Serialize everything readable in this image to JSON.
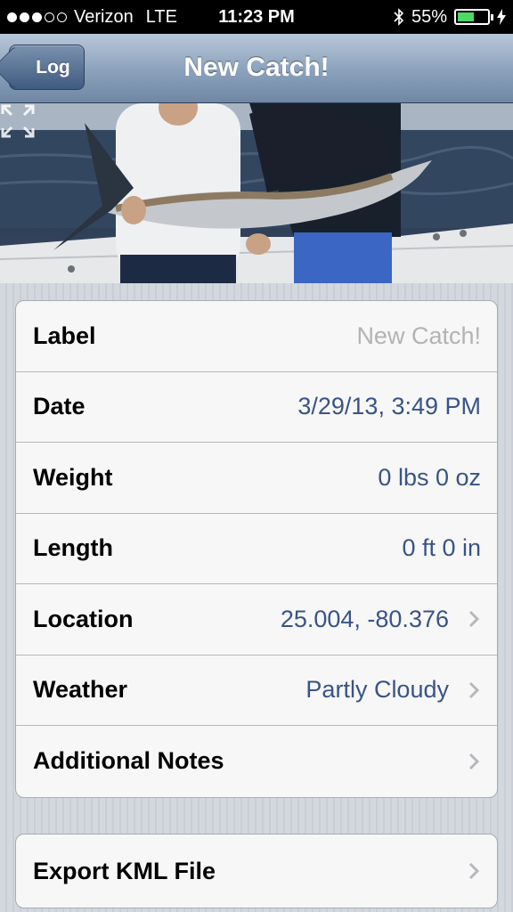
{
  "status_bar": {
    "carrier": "Verizon",
    "network": "LTE",
    "time": "11:23 PM",
    "battery_percent": "55%",
    "battery_level": 0.55,
    "signal_bars": 3,
    "signal_total": 5,
    "icons": [
      "bluetooth-icon",
      "battery-icon",
      "charging-icon"
    ]
  },
  "nav": {
    "back_label": "Log",
    "title": "New Catch!"
  },
  "photo": {
    "expand_icon": "expand-icon"
  },
  "fields": [
    {
      "label": "Label",
      "value": "New Catch!",
      "placeholder": true,
      "chevron": false
    },
    {
      "label": "Date",
      "value": "3/29/13, 3:49 PM",
      "placeholder": false,
      "chevron": false
    },
    {
      "label": "Weight",
      "value": "0 lbs 0 oz",
      "placeholder": false,
      "chevron": false
    },
    {
      "label": "Length",
      "value": "0 ft 0 in",
      "placeholder": false,
      "chevron": false
    },
    {
      "label": "Location",
      "value": "25.004, -80.376",
      "placeholder": false,
      "chevron": true
    },
    {
      "label": "Weather",
      "value": "Partly Cloudy",
      "placeholder": false,
      "chevron": true
    },
    {
      "label": "Additional Notes",
      "value": "",
      "placeholder": false,
      "chevron": true
    }
  ],
  "export": {
    "label": "Export KML File"
  },
  "colors": {
    "value_blue": "#385487",
    "placeholder_gray": "#b3b3b3",
    "nav_blue": "#6f87a4",
    "battery_green": "#4cd964"
  }
}
